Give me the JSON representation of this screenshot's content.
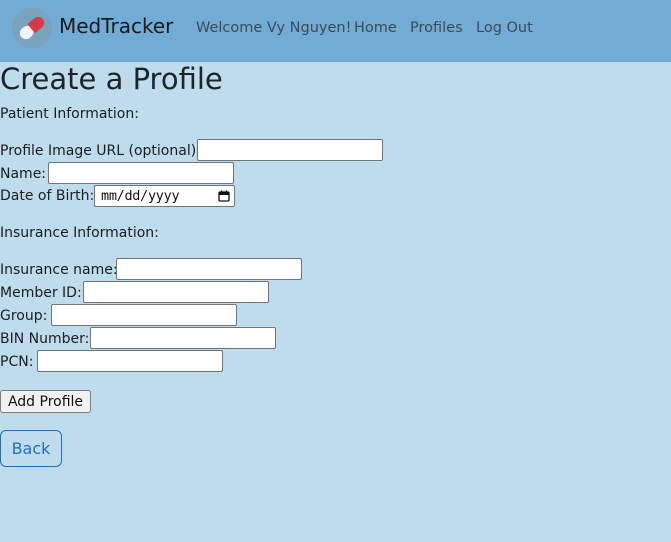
{
  "nav": {
    "brand": "MedTracker",
    "welcome": "Welcome Vy Nguyen!",
    "home": "Home",
    "profiles": "Profiles",
    "logout": "Log Out"
  },
  "page": {
    "title": "Create a Profile"
  },
  "patient_section": {
    "heading": "Patient Information:",
    "image_url_label": "Profile Image URL (optional):",
    "image_url_value": "",
    "name_label": "Name:",
    "name_value": "",
    "dob_label": "Date of Birth:",
    "dob_placeholder": "mm/dd/yyyy"
  },
  "insurance_section": {
    "heading": "Insurance Information:",
    "insurance_name_label": "Insurance name:",
    "member_id_label": "Member ID:",
    "group_label": "Group:",
    "bin_label": "BIN Number:",
    "pcn_label": "PCN:"
  },
  "actions": {
    "add_profile": "Add Profile",
    "back": "Back"
  },
  "colors": {
    "background": "#bfdcec",
    "navbar": "#72acd4",
    "link_blue": "#1d6fc2"
  }
}
